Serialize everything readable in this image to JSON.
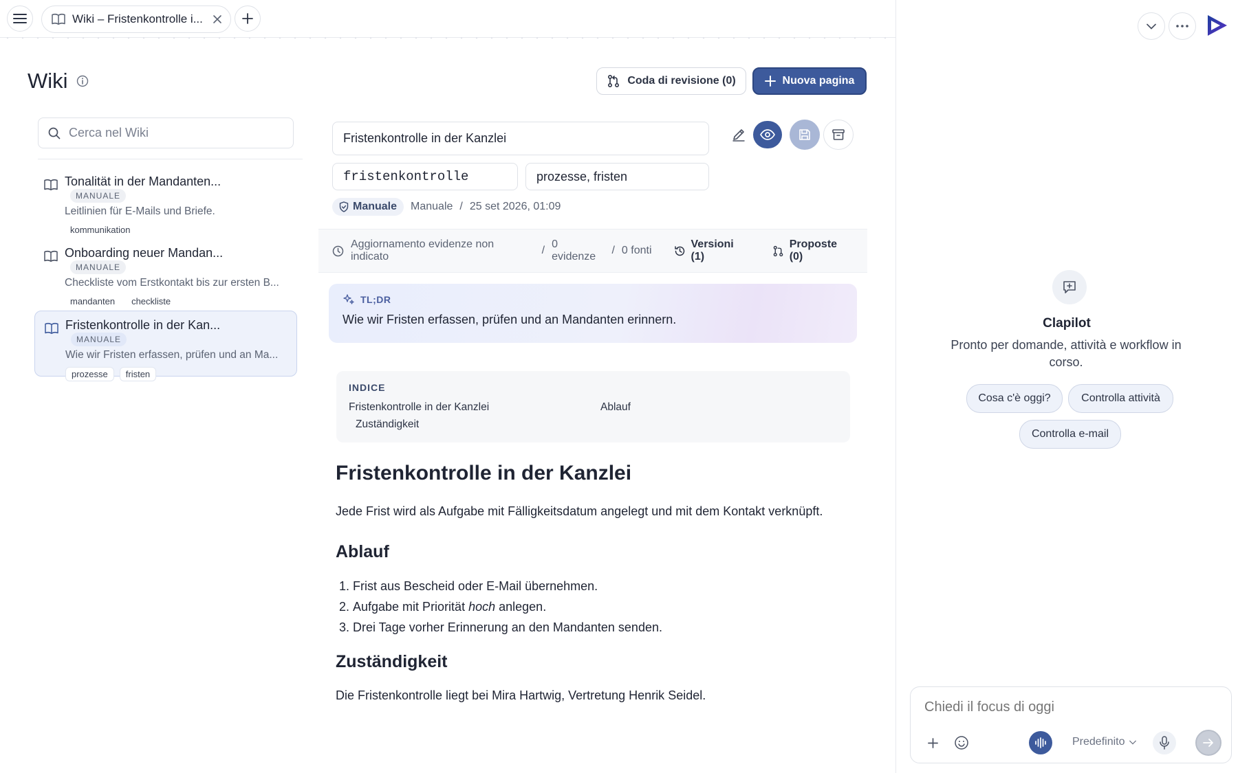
{
  "tab": {
    "title": "Wiki – Fristenkontrolle i..."
  },
  "header": {
    "title": "Wiki",
    "review_queue_label": "Coda di revisione (0)",
    "new_page_label": "Nuova pagina"
  },
  "search": {
    "placeholder": "Cerca nel Wiki"
  },
  "pages": [
    {
      "title": "Tonalität in der Mandanten...",
      "badge": "MANUALE",
      "desc": "Leitlinien für E-Mails und Briefe.",
      "tags": [
        "kommunikation"
      ]
    },
    {
      "title": "Onboarding neuer Mandan...",
      "badge": "MANUALE",
      "desc": "Checkliste vom Erstkontakt bis zur ersten B...",
      "tags": [
        "mandanten",
        "checkliste"
      ]
    },
    {
      "title": "Fristenkontrolle in der Kan...",
      "badge": "MANUALE",
      "desc": "Wie wir Fristen erfassen, prüfen und an Ma...",
      "tags": [
        "prozesse",
        "fristen"
      ]
    }
  ],
  "editor": {
    "title_value": "Fristenkontrolle in der Kanzlei",
    "slug_value": "fristenkontrolle",
    "tags_value": "prozesse, fristen",
    "source_pill": "Manuale",
    "source_text": "Manuale",
    "date": "25 set 2026, 01:09"
  },
  "evidence": {
    "update_text": "Aggiornamento evidenze non indicato",
    "evidence_count": "0 evidenze",
    "sources_count": "0 fonti",
    "versions_label": "Versioni (1)",
    "proposals_label": "Proposte (0)"
  },
  "tldr": {
    "label": "TL;DR",
    "text": "Wie wir Fristen erfassen, prüfen und an Mandanten erinnern."
  },
  "toc": {
    "label": "INDICE",
    "items": [
      "Fristenkontrolle in der Kanzlei",
      "Ablauf",
      "Zuständigkeit"
    ]
  },
  "content": {
    "h1": "Fristenkontrolle in der Kanzlei",
    "intro": "Jede Frist wird als Aufgabe mit Fälligkeitsdatum angelegt und mit dem Kontakt verknüpft.",
    "h2_process": "Ablauf",
    "steps": {
      "step1": "Frist aus Bescheid oder E-Mail übernehmen.",
      "step2_pre": "Aufgabe mit Priorität ",
      "step2_em": "hoch",
      "step2_post": " anlegen.",
      "step3": "Drei Tage vorher Erinnerung an den Mandanten senden."
    },
    "h2_responsibility": "Zuständigkeit",
    "responsibility_text": "Die Fristenkontrolle liegt bei Mira Hartwig, Vertretung Henrik Seidel."
  },
  "assistant": {
    "name": "Clapilot",
    "subtitle": "Pronto per domande, attività e workflow in corso.",
    "suggestions": [
      "Cosa c'è oggi?",
      "Controlla attività",
      "Controlla e-mail"
    ],
    "input_placeholder": "Chiedi il focus di oggi",
    "model_label": "Predefinito"
  },
  "colors": {
    "primary": "#3d5a9c",
    "accent_text": "#4b5fa0",
    "active_item_bg": "#eef2fb"
  }
}
